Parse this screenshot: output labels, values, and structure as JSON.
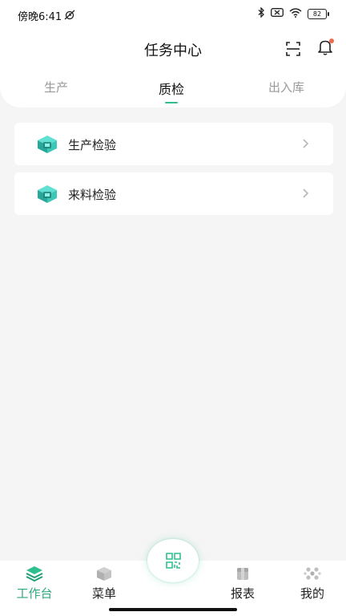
{
  "status_bar": {
    "time_text": "傍晚6:41",
    "battery_level": "82"
  },
  "header": {
    "title": "任务中心"
  },
  "tabs": [
    {
      "label": "生产",
      "active": false
    },
    {
      "label": "质检",
      "active": true
    },
    {
      "label": "出入库",
      "active": false
    }
  ],
  "list": [
    {
      "label": "生产检验",
      "icon": "cube-icon"
    },
    {
      "label": "来料检验",
      "icon": "cube-icon"
    }
  ],
  "bottom_nav": [
    {
      "label": "工作台",
      "icon": "layers-icon",
      "active": true
    },
    {
      "label": "菜单",
      "icon": "box-icon",
      "active": false
    },
    {
      "label": "报表",
      "icon": "package-icon",
      "active": false
    },
    {
      "label": "我的",
      "icon": "dots-icon",
      "active": false
    }
  ],
  "fab": {
    "icon": "qr-code-icon"
  },
  "colors": {
    "accent": "#2fbf8f",
    "active_nav": "#2fa87f",
    "notification_dot": "#f06a4f",
    "background": "#f5f5f5"
  }
}
